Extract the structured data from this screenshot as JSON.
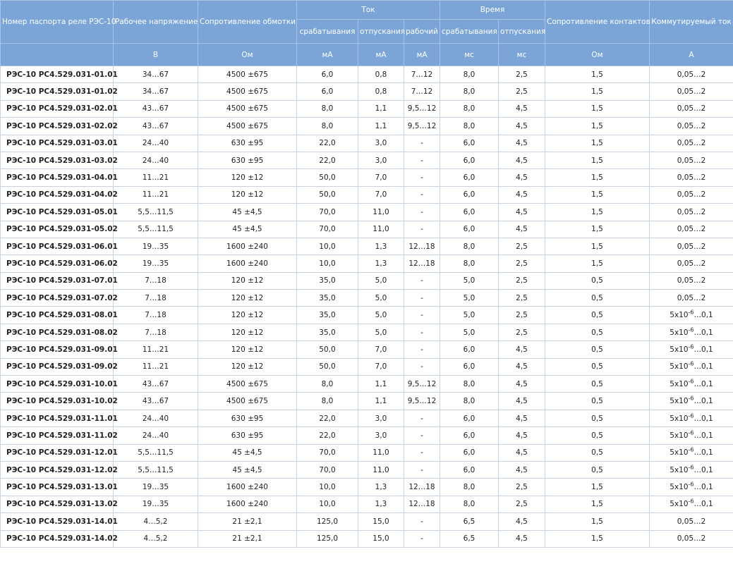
{
  "header": {
    "col_passport": "Номер паспорта реле РЭС-10",
    "col_voltage": "Рабочее напряжение",
    "col_resistance": "Сопротивление обмотки",
    "group_current": "Ток",
    "group_time": "Время",
    "current_pickup": "срабатывания",
    "current_release": "отпускания",
    "current_working": "рабочий",
    "time_pickup": "срабатывания",
    "time_release": "отпускания",
    "col_contact_resistance": "Сопротивление контактов",
    "col_switched_current": "Коммутируемый ток",
    "units": [
      "В",
      "Ом",
      "мА",
      "мА",
      "мА",
      "мс",
      "мс",
      "Ом",
      "А"
    ]
  },
  "switched_small": {
    "base": "5x10",
    "exp": "-6",
    "rest": "…0,1"
  },
  "rows": [
    [
      "РЭС-10 РС4.529.031-01.01",
      "34…67",
      "4500 ±675",
      "6,0",
      "0,8",
      "7…12",
      "8,0",
      "2,5",
      "1,5",
      "0,05…2"
    ],
    [
      "РЭС-10 РС4.529.031-01.02",
      "34…67",
      "4500 ±675",
      "6,0",
      "0,8",
      "7…12",
      "8,0",
      "2,5",
      "1,5",
      "0,05…2"
    ],
    [
      "РЭС-10 РС4.529.031-02.01",
      "43…67",
      "4500 ±675",
      "8,0",
      "1,1",
      "9,5…12",
      "8,0",
      "4,5",
      "1,5",
      "0,05…2"
    ],
    [
      "РЭС-10 РС4.529.031-02.02",
      "43…67",
      "4500 ±675",
      "8,0",
      "1,1",
      "9,5…12",
      "8,0",
      "4,5",
      "1,5",
      "0,05…2"
    ],
    [
      "РЭС-10 РС4.529.031-03.01",
      "24…40",
      "630 ±95",
      "22,0",
      "3,0",
      "-",
      "6,0",
      "4,5",
      "1,5",
      "0,05…2"
    ],
    [
      "РЭС-10 РС4.529.031-03.02",
      "24…40",
      "630 ±95",
      "22,0",
      "3,0",
      "-",
      "6,0",
      "4,5",
      "1,5",
      "0,05…2"
    ],
    [
      "РЭС-10 РС4.529.031-04.01",
      "11…21",
      "120 ±12",
      "50,0",
      "7,0",
      "-",
      "6,0",
      "4,5",
      "1,5",
      "0,05…2"
    ],
    [
      "РЭС-10 РС4.529.031-04.02",
      "11…21",
      "120 ±12",
      "50,0",
      "7,0",
      "-",
      "6,0",
      "4,5",
      "1,5",
      "0,05…2"
    ],
    [
      "РЭС-10 РС4.529.031-05.01",
      "5,5…11,5",
      "45 ±4,5",
      "70,0",
      "11,0",
      "-",
      "6,0",
      "4,5",
      "1,5",
      "0,05…2"
    ],
    [
      "РЭС-10 РС4.529.031-05.02",
      "5,5…11,5",
      "45 ±4,5",
      "70,0",
      "11,0",
      "-",
      "6,0",
      "4,5",
      "1,5",
      "0,05…2"
    ],
    [
      "РЭС-10 РС4.529.031-06.01",
      "19…35",
      "1600 ±240",
      "10,0",
      "1,3",
      "12…18",
      "8,0",
      "2,5",
      "1,5",
      "0,05…2"
    ],
    [
      "РЭС-10 РС4.529.031-06.02",
      "19…35",
      "1600 ±240",
      "10,0",
      "1,3",
      "12…18",
      "8,0",
      "2,5",
      "1,5",
      "0,05…2"
    ],
    [
      "РЭС-10 РС4.529.031-07.01",
      "7…18",
      "120 ±12",
      "35,0",
      "5,0",
      "-",
      "5,0",
      "2,5",
      "0,5",
      "0,05…2"
    ],
    [
      "РЭС-10 РС4.529.031-07.02",
      "7…18",
      "120 ±12",
      "35,0",
      "5,0",
      "-",
      "5,0",
      "2,5",
      "0,5",
      "0,05…2"
    ],
    [
      "РЭС-10 РС4.529.031-08.01",
      "7…18",
      "120 ±12",
      "35,0",
      "5,0",
      "-",
      "5,0",
      "2,5",
      "0,5",
      "SMALL"
    ],
    [
      "РЭС-10 РС4.529.031-08.02",
      "7…18",
      "120 ±12",
      "35,0",
      "5,0",
      "-",
      "5,0",
      "2,5",
      "0,5",
      "SMALL"
    ],
    [
      "РЭС-10 РС4.529.031-09.01",
      "11…21",
      "120 ±12",
      "50,0",
      "7,0",
      "-",
      "6,0",
      "4,5",
      "0,5",
      "SMALL"
    ],
    [
      "РЭС-10 РС4.529.031-09.02",
      "11…21",
      "120 ±12",
      "50,0",
      "7,0",
      "-",
      "6,0",
      "4,5",
      "0,5",
      "SMALL"
    ],
    [
      "РЭС-10 РС4.529.031-10.01",
      "43…67",
      "4500 ±675",
      "8,0",
      "1,1",
      "9,5…12",
      "8,0",
      "4,5",
      "0,5",
      "SMALL"
    ],
    [
      "РЭС-10 РС4.529.031-10.02",
      "43…67",
      "4500 ±675",
      "8,0",
      "1,1",
      "9,5…12",
      "8,0",
      "4,5",
      "0,5",
      "SMALL"
    ],
    [
      "РЭС-10 РС4.529.031-11.01",
      "24…40",
      "630 ±95",
      "22,0",
      "3,0",
      "-",
      "6,0",
      "4,5",
      "0,5",
      "SMALL"
    ],
    [
      "РЭС-10 РС4.529.031-11.02",
      "24…40",
      "630 ±95",
      "22,0",
      "3,0",
      "-",
      "6,0",
      "4,5",
      "0,5",
      "SMALL"
    ],
    [
      "РЭС-10 РС4.529.031-12.01",
      "5,5…11,5",
      "45 ±4,5",
      "70,0",
      "11,0",
      "-",
      "6,0",
      "4,5",
      "0,5",
      "SMALL"
    ],
    [
      "РЭС-10 РС4.529.031-12.02",
      "5,5…11,5",
      "45 ±4,5",
      "70,0",
      "11,0",
      "-",
      "6,0",
      "4,5",
      "0,5",
      "SMALL"
    ],
    [
      "РЭС-10 РС4.529.031-13.01",
      "19…35",
      "1600 ±240",
      "10,0",
      "1,3",
      "12…18",
      "8,0",
      "2,5",
      "1,5",
      "SMALL"
    ],
    [
      "РЭС-10 РС4.529.031-13.02",
      "19…35",
      "1600 ±240",
      "10,0",
      "1,3",
      "12…18",
      "8,0",
      "2,5",
      "1,5",
      "SMALL"
    ],
    [
      "РЭС-10 РС4.529.031-14.01",
      "4…5,2",
      "21 ±2,1",
      "125,0",
      "15,0",
      "-",
      "6,5",
      "4,5",
      "1,5",
      "0,05…2"
    ],
    [
      "РЭС-10 РС4.529.031-14.02",
      "4…5,2",
      "21 ±2,1",
      "125,0",
      "15,0",
      "-",
      "6,5",
      "4,5",
      "1,5",
      "0,05…2"
    ]
  ]
}
